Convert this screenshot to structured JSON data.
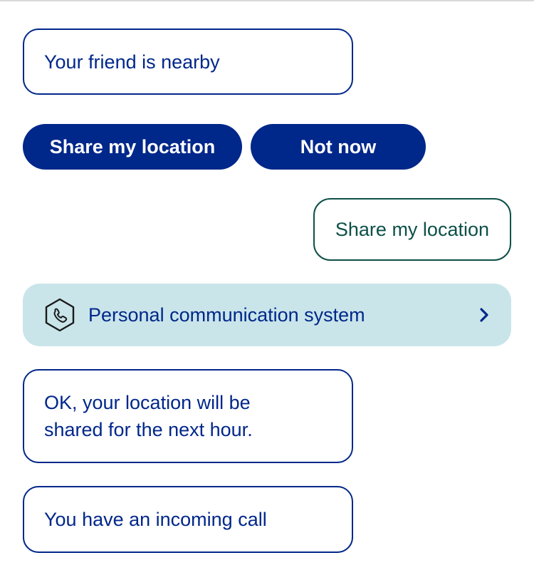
{
  "conversation": {
    "friend_message": "Your friend is nearby",
    "quick_replies": {
      "share_label": "Share my location",
      "decline_label": "Not now"
    },
    "user_reply": "Share my location",
    "system_card": {
      "icon": "phone-hexagon-icon",
      "label": "Personal communication system",
      "chevron_icon": "chevron-right-icon"
    },
    "confirmation_message": "OK, your location will be shared for the next hour.",
    "call_message": "You have an incoming call"
  },
  "colors": {
    "primary": "#00278a",
    "user_bubble_border": "#0d5048",
    "system_card_bg": "#c9e5ea"
  }
}
